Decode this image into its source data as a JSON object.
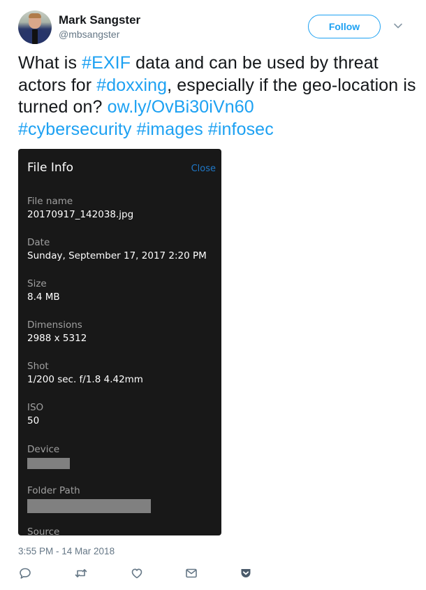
{
  "author": {
    "name": "Mark Sangster",
    "handle": "@mbsangster",
    "avatar_icon": "profile-photo"
  },
  "header": {
    "follow_label": "Follow",
    "more_icon": "chevron-down-icon"
  },
  "tweet": {
    "segments": [
      {
        "text": "What is ",
        "type": "text"
      },
      {
        "text": "#EXIF",
        "type": "hashtag"
      },
      {
        "text": " data and can be used by threat actors for ",
        "type": "text"
      },
      {
        "text": "#doxxing",
        "type": "hashtag"
      },
      {
        "text": ", especially if the geo-location is turned on? ",
        "type": "text"
      },
      {
        "text": "ow.ly/OvBi30iVn60",
        "type": "url"
      },
      {
        "text": " ",
        "type": "text"
      },
      {
        "text": "#cybersecurity",
        "type": "hashtag"
      },
      {
        "text": " ",
        "type": "text"
      },
      {
        "text": "#images",
        "type": "hashtag"
      },
      {
        "text": " ",
        "type": "text"
      },
      {
        "text": "#infosec",
        "type": "hashtag"
      }
    ],
    "link_color": "#1da1f2"
  },
  "media": {
    "title": "File Info",
    "close_label": "Close",
    "fields": [
      {
        "label": "File name",
        "value": "20170917_142038.jpg"
      },
      {
        "label": "Date",
        "value": "Sunday, September 17, 2017 2:20 PM"
      },
      {
        "label": "Size",
        "value": "8.4 MB"
      },
      {
        "label": "Dimensions",
        "value": "2988 x 5312"
      },
      {
        "label": "Shot",
        "value": "1/200 sec. f/1.8 4.42mm"
      },
      {
        "label": "ISO",
        "value": "50"
      },
      {
        "label": "Device",
        "value": null,
        "redacted": true
      },
      {
        "label": "Folder Path",
        "value": null,
        "redacted": true
      },
      {
        "label": "Source",
        "value": null
      }
    ]
  },
  "footer": {
    "timestamp": "3:55 PM - 14 Mar 2018",
    "actions": [
      {
        "name": "reply",
        "icon": "reply-icon"
      },
      {
        "name": "retweet",
        "icon": "retweet-icon"
      },
      {
        "name": "like",
        "icon": "heart-icon"
      },
      {
        "name": "direct-message",
        "icon": "envelope-icon"
      },
      {
        "name": "pocket",
        "icon": "pocket-icon"
      }
    ]
  }
}
